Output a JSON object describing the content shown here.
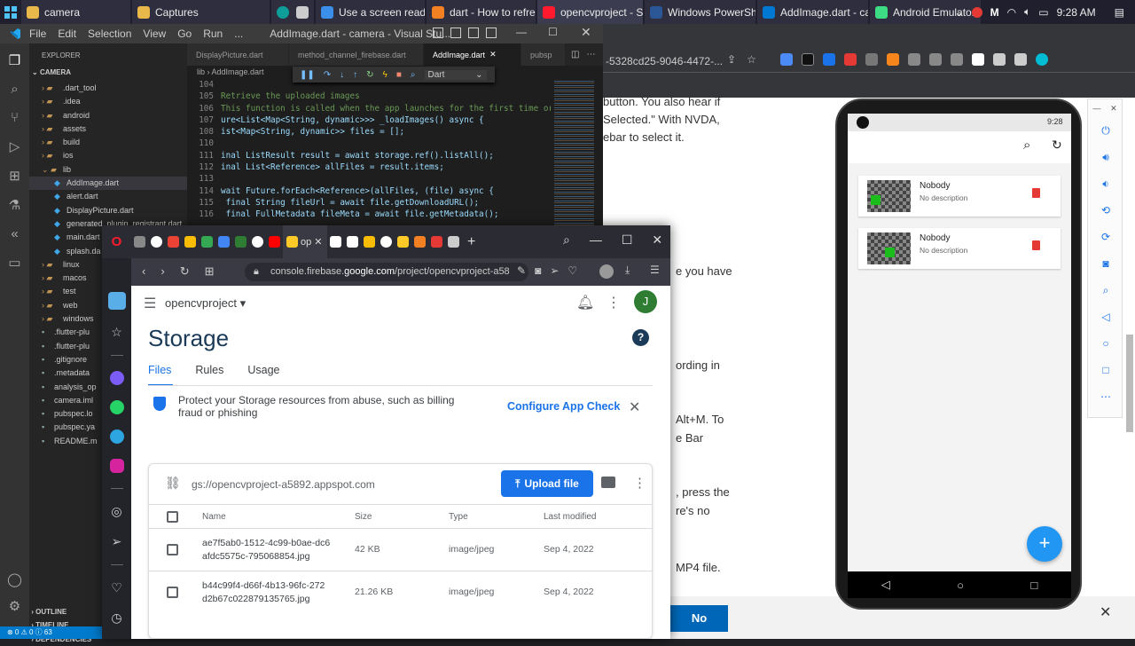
{
  "taskbar": {
    "items": [
      {
        "label": "camera",
        "color": "#e8b84a"
      },
      {
        "label": "Captures",
        "color": "#e8b84a"
      },
      {
        "label": "Use a screen reader ...",
        "color": "#3b8eea"
      },
      {
        "label": "dart - How to refres...",
        "color": "#f48024"
      },
      {
        "label": "opencvproject - Stor...",
        "color": "#ff1b2d"
      },
      {
        "label": "Windows PowerShell",
        "color": "#2b5797"
      },
      {
        "label": "AddImage.dart - ca...",
        "color": "#0078d4"
      },
      {
        "label": "Android Emulator - ...",
        "color": "#3ddc84"
      }
    ],
    "clock": "9:28 AM"
  },
  "vscode": {
    "title": "AddImage.dart - camera - Visual Stu...",
    "menu": [
      "File",
      "Edit",
      "Selection",
      "View",
      "Go",
      "Run",
      "..."
    ],
    "explorer_label": "EXPLORER",
    "project": "CAMERA",
    "tree": [
      {
        "label": ".dart_tool",
        "indent": 1,
        "type": "folder"
      },
      {
        "label": ".idea",
        "indent": 1,
        "type": "folder"
      },
      {
        "label": "android",
        "indent": 1,
        "type": "folder"
      },
      {
        "label": "assets",
        "indent": 1,
        "type": "folder"
      },
      {
        "label": "build",
        "indent": 1,
        "type": "folder"
      },
      {
        "label": "ios",
        "indent": 1,
        "type": "folder"
      },
      {
        "label": "lib",
        "indent": 1,
        "type": "folder-open"
      },
      {
        "label": "AddImage.dart",
        "indent": 2,
        "type": "dart",
        "selected": true
      },
      {
        "label": "alert.dart",
        "indent": 2,
        "type": "dart"
      },
      {
        "label": "DisplayPicture.dart",
        "indent": 2,
        "type": "dart"
      },
      {
        "label": "generated_plugin_registrant.dart",
        "indent": 2,
        "type": "dart"
      },
      {
        "label": "main.dart",
        "indent": 2,
        "type": "dart"
      },
      {
        "label": "splash.da",
        "indent": 2,
        "type": "dart"
      },
      {
        "label": "linux",
        "indent": 1,
        "type": "folder"
      },
      {
        "label": "macos",
        "indent": 1,
        "type": "folder"
      },
      {
        "label": "test",
        "indent": 1,
        "type": "folder"
      },
      {
        "label": "web",
        "indent": 1,
        "type": "folder"
      },
      {
        "label": "windows",
        "indent": 1,
        "type": "folder"
      },
      {
        "label": ".flutter-plu",
        "indent": 1,
        "type": "file"
      },
      {
        "label": ".flutter-plu",
        "indent": 1,
        "type": "file"
      },
      {
        "label": ".gitignore",
        "indent": 1,
        "type": "file"
      },
      {
        "label": ".metadata",
        "indent": 1,
        "type": "file"
      },
      {
        "label": "analysis_op",
        "indent": 1,
        "type": "file"
      },
      {
        "label": "camera.iml",
        "indent": 1,
        "type": "file"
      },
      {
        "label": "pubspec.lo",
        "indent": 1,
        "type": "file"
      },
      {
        "label": "pubspec.ya",
        "indent": 1,
        "type": "file"
      },
      {
        "label": "README.m",
        "indent": 1,
        "type": "file"
      }
    ],
    "bottom_sections": [
      "OUTLINE",
      "TIMELINE",
      "DEPENDENCIES"
    ],
    "status": "⊗ 0 ⚠ 0  ⓘ 63",
    "tabs": [
      "DisplayPicture.dart",
      "method_channel_firebase.dart",
      "AddImage.dart",
      "pubsp"
    ],
    "breadcrumb": "lib › AddImage.dart",
    "language": "Dart",
    "code": [
      {
        "n": "104",
        "t": ""
      },
      {
        "n": "105",
        "t": "Retrieve the uploaded images"
      },
      {
        "n": "106",
        "t": "This function is called when the app launches for the first time or"
      },
      {
        "n": "107",
        "t": "ure<List<Map<String, dynamic>>> _loadImages() async {"
      },
      {
        "n": "108",
        "t": "ist<Map<String, dynamic>> files = [];"
      },
      {
        "n": "110",
        "t": ""
      },
      {
        "n": "111",
        "t": "inal ListResult result = await storage.ref().listAll();"
      },
      {
        "n": "112",
        "t": "inal List<Reference> allFiles = result.items;"
      },
      {
        "n": "113",
        "t": ""
      },
      {
        "n": "114",
        "t": "wait Future.forEach<Reference>(allFiles, (file) async {"
      },
      {
        "n": "115",
        "t": " final String fileUrl = await file.getDownloadURL();"
      },
      {
        "n": "116",
        "t": " final FullMetadata fileMeta = await file.getMetadata();"
      }
    ]
  },
  "web_fragments": [
    "button.  You also hear if",
    "Selected.\" With NVDA,",
    "ebar to select it.",
    "e you have",
    "ording in",
    "Alt+M. To",
    "e Bar",
    ", press the",
    "re's no",
    "MP4 file.",
    "No"
  ],
  "web_url": "-5328cd25-9046-4472-...",
  "browser": {
    "tab_title": "op",
    "url_prefix": "console.firebase.",
    "url_domain": "google.com",
    "url_suffix": "/project/opencvproject-a58",
    "project": "opencvproject",
    "avatar": "J",
    "page_title": "Storage",
    "tabs": [
      "Files",
      "Rules",
      "Usage"
    ],
    "banner_text": "Protect your Storage resources from abuse, such as billing fraud or phishing",
    "banner_action": "Configure App Check",
    "bucket": "gs://opencvproject-a5892.appspot.com",
    "upload_label": "Upload file",
    "columns": [
      "Name",
      "Size",
      "Type",
      "Last modified"
    ],
    "rows": [
      {
        "name_line1": "ae7f5ab0-1512-4c99-b0ae-dc6",
        "name_line2": "afdc5575c-795068854.jpg",
        "size": "42 KB",
        "type": "image/jpeg",
        "modified": "Sep 4, 2022"
      },
      {
        "name_line1": "b44c99f4-d66f-4b13-96fc-272",
        "name_line2": "d2b67c022879135765.jpg",
        "size": "21.26 KB",
        "type": "image/jpeg",
        "modified": "Sep 4, 2022"
      }
    ]
  },
  "emulator": {
    "status_time": "9:28",
    "items": [
      {
        "title": "Nobody",
        "subtitle": "No description"
      },
      {
        "title": "Nobody",
        "subtitle": "No description"
      }
    ],
    "fab_icon": "+",
    "accent": "#2196f3",
    "delete_color": "#e53935"
  }
}
